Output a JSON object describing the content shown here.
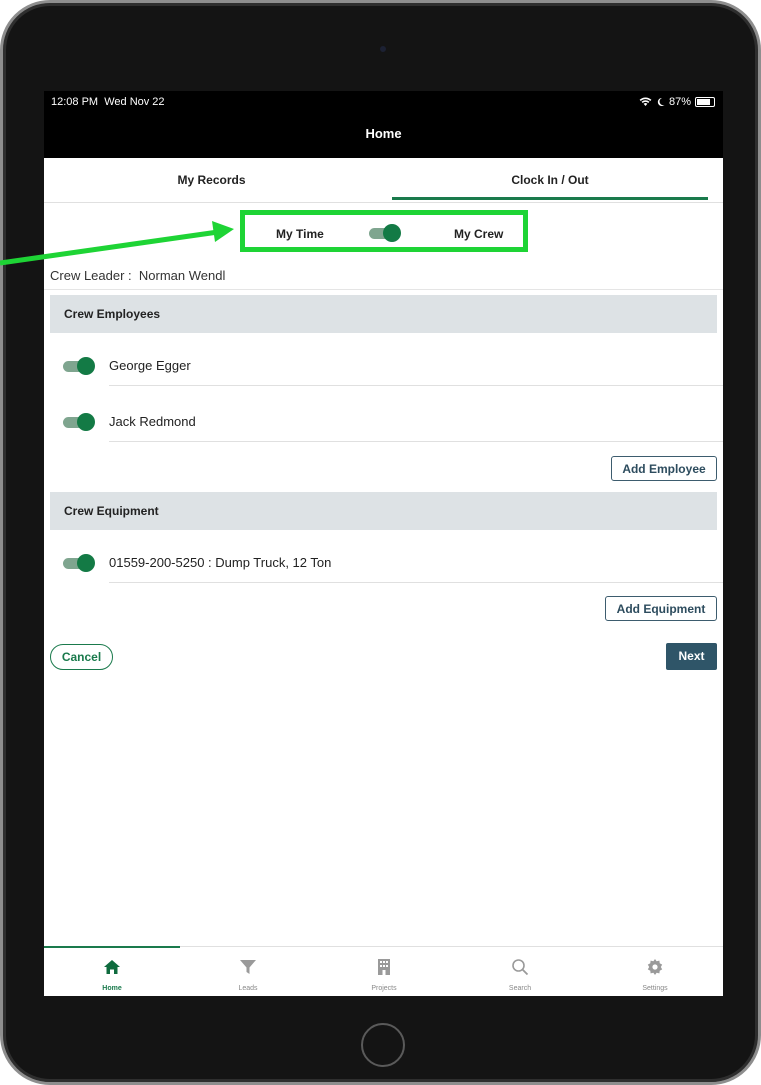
{
  "status": {
    "time": "12:08 PM",
    "date": "Wed Nov 22",
    "battery": "87%"
  },
  "nav": {
    "title": "Home"
  },
  "tabs": [
    {
      "label": "My Records"
    },
    {
      "label": "Clock In / Out"
    }
  ],
  "mode_toggle": {
    "left_label": "My Time",
    "right_label": "My Crew",
    "on": true
  },
  "crew_leader": {
    "label": "Crew Leader :",
    "name": "Norman Wendl"
  },
  "employees": {
    "heading": "Crew Employees",
    "items": [
      {
        "name": "George Egger",
        "on": true
      },
      {
        "name": "Jack Redmond",
        "on": true
      }
    ],
    "add_label": "Add Employee"
  },
  "equipment": {
    "heading": "Crew Equipment",
    "items": [
      {
        "name": "01559-200-5250 : Dump Truck, 12 Ton",
        "on": true
      }
    ],
    "add_label": "Add Equipment"
  },
  "actions": {
    "cancel": "Cancel",
    "next": "Next"
  },
  "bottom_nav": [
    {
      "label": "Home",
      "icon": "home-icon",
      "active": true
    },
    {
      "label": "Leads",
      "icon": "filter-icon",
      "active": false
    },
    {
      "label": "Projects",
      "icon": "building-icon",
      "active": false
    },
    {
      "label": "Search",
      "icon": "search-icon",
      "active": false
    },
    {
      "label": "Settings",
      "icon": "gear-icon",
      "active": false
    }
  ],
  "colors": {
    "accent": "#1a7a4c",
    "highlight": "#1ed435",
    "primary_button": "#2f5568",
    "section_bg": "#dde2e5"
  }
}
